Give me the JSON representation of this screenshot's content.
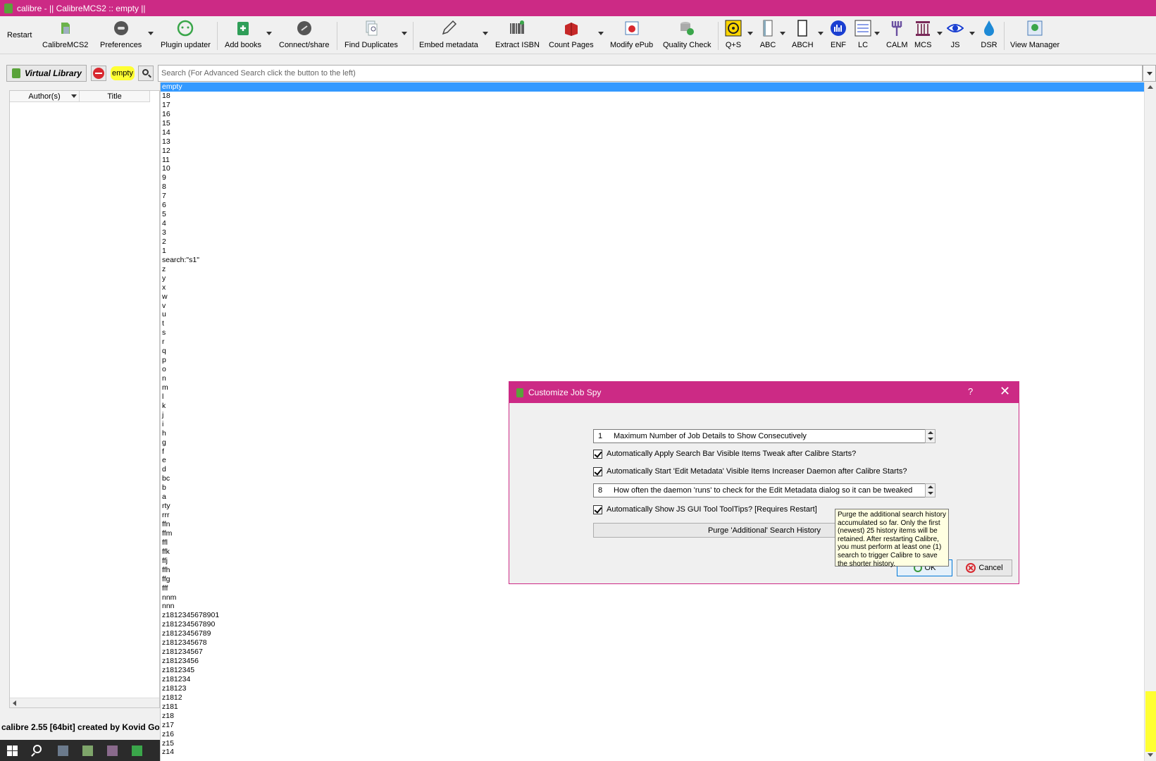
{
  "window": {
    "title": "calibre - || CalibreMCS2 :: empty ||"
  },
  "toolbar": {
    "restart": "Restart",
    "items": [
      {
        "label": "CalibreMCS2",
        "icon": "library-icon"
      },
      {
        "label": "Preferences",
        "icon": "preferences-icon"
      },
      {
        "label": "Plugin updater",
        "icon": "plugin-updater-icon"
      },
      {
        "label": "Add books",
        "icon": "add-books-icon"
      },
      {
        "label": "Connect/share",
        "icon": "connect-share-icon"
      },
      {
        "label": "Find Duplicates",
        "icon": "find-duplicates-icon"
      },
      {
        "label": "Embed metadata",
        "icon": "embed-metadata-icon"
      },
      {
        "label": "Extract ISBN",
        "icon": "barcode-icon"
      },
      {
        "label": "Count Pages",
        "icon": "count-pages-icon"
      },
      {
        "label": "Modify ePub",
        "icon": "modify-epub-icon"
      },
      {
        "label": "Quality Check",
        "icon": "quality-check-icon"
      },
      {
        "label": "Q+S",
        "icon": "biohazard-icon"
      },
      {
        "label": "ABC",
        "icon": "abc-book-icon"
      },
      {
        "label": "ABCH",
        "icon": "abch-book-icon"
      },
      {
        "label": "ENF",
        "icon": "enf-chart-icon"
      },
      {
        "label": "LC",
        "icon": "lc-icon"
      },
      {
        "label": "CALM",
        "icon": "calm-fork-icon"
      },
      {
        "label": "MCS",
        "icon": "mcs-column-icon"
      },
      {
        "label": "JS",
        "icon": "eye-icon"
      },
      {
        "label": "DSR",
        "icon": "drop-icon"
      },
      {
        "label": "View Manager",
        "icon": "view-manager-icon"
      }
    ]
  },
  "search": {
    "virtual_library": "Virtual Library",
    "restriction": "empty",
    "placeholder": "Search (For Advanced Search click the button to the left)"
  },
  "booklist": {
    "columns": [
      "Author(s)",
      "Title"
    ]
  },
  "completer": {
    "items": [
      "empty",
      "18",
      "17",
      "16",
      "15",
      "14",
      "13",
      "12",
      "11",
      "10",
      "9",
      "8",
      "7",
      "6",
      "5",
      "4",
      "3",
      "2",
      "1",
      "search:\"s1\"",
      "z",
      "y",
      "x",
      "w",
      "v",
      "u",
      "t",
      "s",
      "r",
      "q",
      "p",
      "o",
      "n",
      "m",
      "l",
      "k",
      "j",
      "i",
      "h",
      "g",
      "f",
      "e",
      "d",
      "bc",
      "b",
      "a",
      "rty",
      "rrr",
      "ffn",
      "ffm",
      "ffl",
      "ffk",
      "ffj",
      "ffh",
      "ffg",
      "fff",
      "nnm",
      "nnn",
      "z1812345678901",
      "z181234567890",
      "z18123456789",
      "z1812345678",
      "z181234567",
      "z18123456",
      "z1812345",
      "z181234",
      "z18123",
      "z1812",
      "z181",
      "z18",
      "z17",
      "z16",
      "z15",
      "z14"
    ]
  },
  "status": {
    "text": "calibre 2.55 [64bit] created by Kovid Go"
  },
  "dialog": {
    "title": "Customize Job Spy",
    "help": "?",
    "close": "✕",
    "max_jobs_value": "1",
    "max_jobs_label": "Maximum Number of Job Details to Show Consecutively",
    "check1": "Automatically Apply Search Bar Visible Items Tweak after Calibre Starts?",
    "check2": "Automatically Start 'Edit Metadata' Visible Items Increaser Daemon after Calibre Starts?",
    "daemon_value": "8",
    "daemon_label": "How often the daemon 'runs' to check for the Edit Metadata dialog so it can be tweaked",
    "check3": "Automatically Show JS GUI Tool ToolTips? [Requires Restart]",
    "purge": "Purge 'Additional' Search History",
    "ok": "OK",
    "cancel": "Cancel",
    "tooltip": "Purge the additional search history accumulated so far. Only the first (newest) 25 history items will be retained. After restarting Calibre, you must perform at least one (1) search to trigger Calibre to save the shorter history."
  },
  "colors": {
    "accent": "#cc2a85",
    "selection": "#3399ff",
    "highlight": "#ffff33"
  }
}
